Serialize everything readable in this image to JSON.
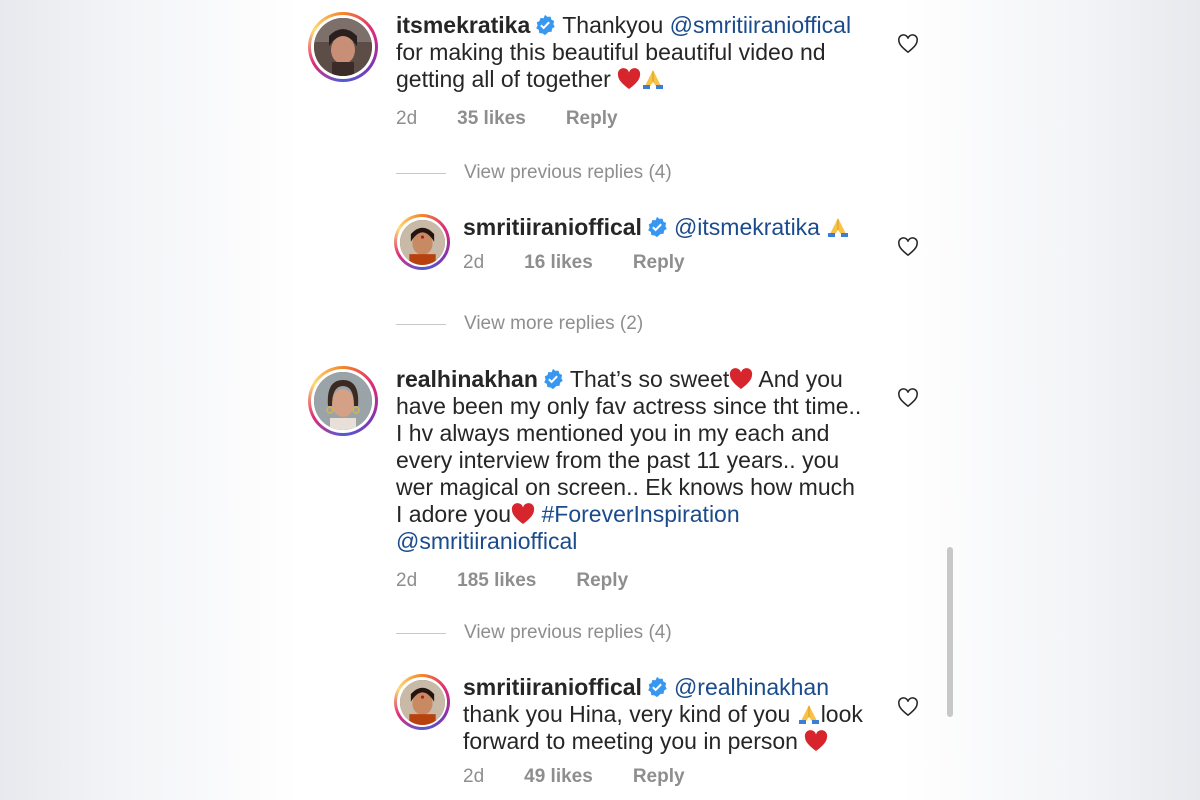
{
  "comments": [
    {
      "username": "itsmekratika",
      "text_1": "Thankyou",
      "mention": "@smritiiranioffical",
      "text_2": "for making this beautiful beautiful video nd getting all of together",
      "time": "2d",
      "likes": "35 likes",
      "reply": "Reply"
    },
    {
      "username": "smritiiranioffical",
      "mention": "@itsmekratika",
      "time": "2d",
      "likes": "16 likes",
      "reply": "Reply"
    },
    {
      "username": "realhinakhan",
      "text_1": "That’s so sweet",
      "text_2": "And you have been my only fav actress since tht time.. I hv always mentioned you in my each and every interview from the past 11 years.. you wer magical on screen.. Ek knows how much I adore you",
      "hashtag": "#ForeverInspiration",
      "mention": "@smritiiranioffical",
      "time": "2d",
      "likes": "185 likes",
      "reply": "Reply"
    },
    {
      "username": "smritiiranioffical",
      "mention": "@realhinakhan",
      "text_1": "thank you Hina, very kind of you",
      "text_2": "look forward to meeting you in person",
      "time": "2d",
      "likes": "49 likes",
      "reply": "Reply"
    }
  ],
  "view_replies": [
    "View previous replies (4)",
    "View more replies (2)",
    "View previous replies (4)"
  ],
  "colors": {
    "mention": "#1a4b8c",
    "verified": "#3897f0",
    "heart": "#d7252d",
    "muted": "#8e8e8e"
  }
}
